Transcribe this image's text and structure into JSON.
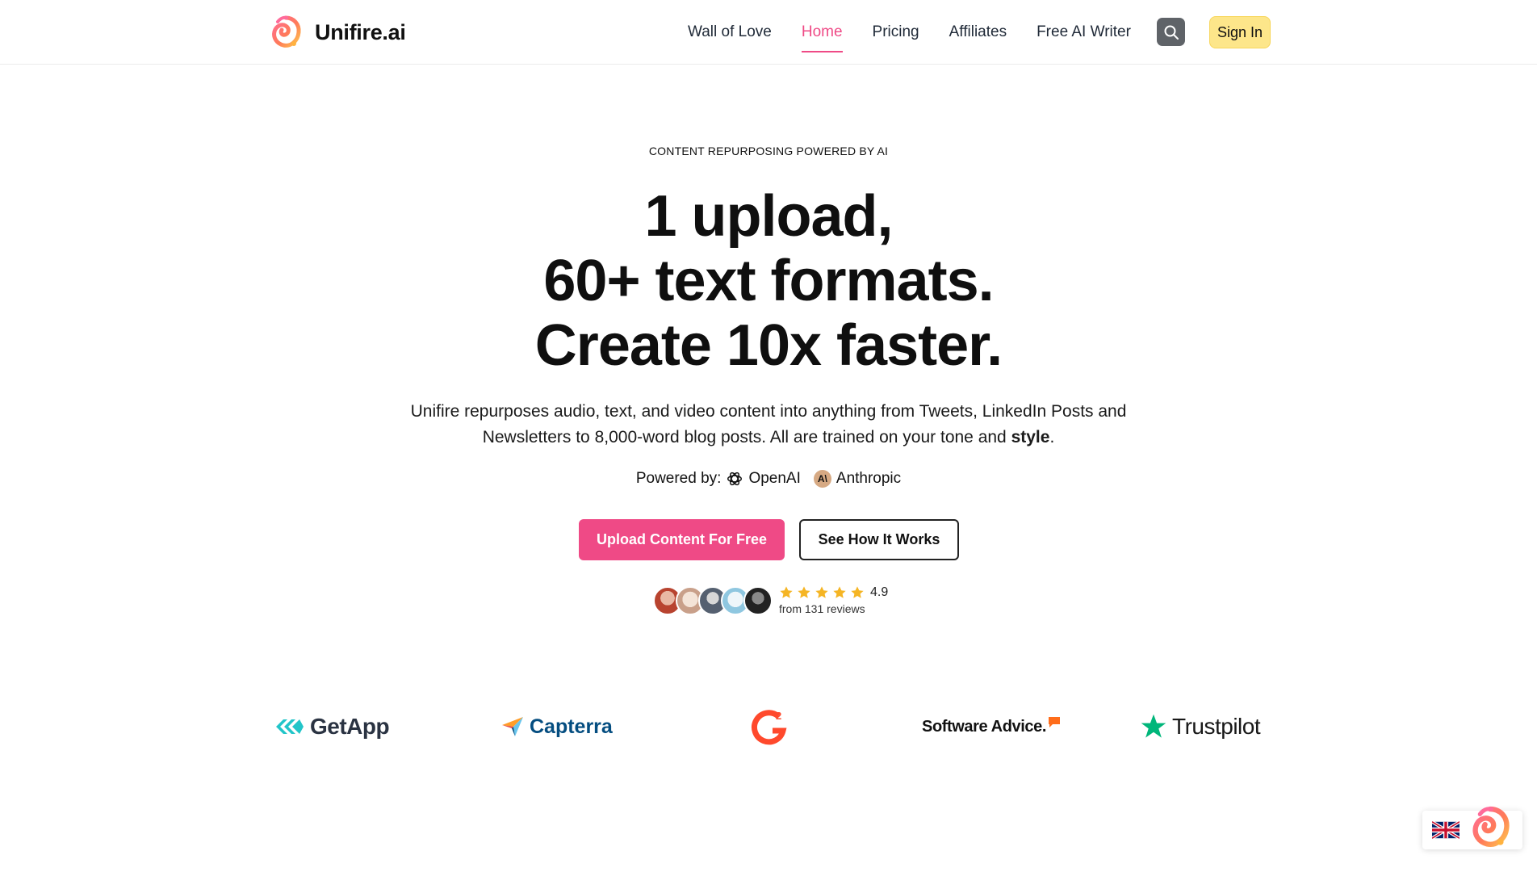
{
  "brand": {
    "name": "Unifire.ai",
    "logo_icon": "unifire-swirl-logo",
    "accent": "#ef4a86"
  },
  "nav": {
    "links": [
      {
        "label": "Wall of Love",
        "active": false
      },
      {
        "label": "Home",
        "active": true
      },
      {
        "label": "Pricing",
        "active": false
      },
      {
        "label": "Affiliates",
        "active": false
      },
      {
        "label": "Free AI Writer",
        "active": false
      }
    ],
    "search_icon": "search-icon",
    "sign_in_label": "Sign In"
  },
  "hero": {
    "eyebrow": "CONTENT REPURPOSING POWERED BY AI",
    "headline_lines": [
      "1 upload,",
      "60+ text formats.",
      "Create 10x faster."
    ],
    "subtext_main": "Unifire repurposes audio, text, and video content into anything from Tweets, LinkedIn Posts and Newsletters to 8,000-word blog posts. All are trained on your tone and ",
    "subtext_bold": "style",
    "subtext_end": ".",
    "powered_label": "Powered by:",
    "providers": [
      {
        "name": "OpenAI",
        "icon": "openai-icon"
      },
      {
        "name": "Anthropic",
        "icon": "anthropic-icon"
      }
    ],
    "primary_cta": "Upload Content For Free",
    "secondary_cta": "See How It Works",
    "rating": {
      "value": "4.9",
      "stars": 5,
      "subtitle": "from 131 reviews"
    }
  },
  "review_platforms": [
    "GetApp",
    "Capterra",
    "G2",
    "Software Advice.",
    "Trustpilot"
  ],
  "widget": {
    "flag": "uk-flag-icon",
    "logo_icon": "unifire-swirl-logo"
  },
  "colors": {
    "primary": "#ef4a86",
    "sign_in_bg": "#fde68a",
    "star": "#f5b524",
    "search_bg": "#5f6368"
  }
}
